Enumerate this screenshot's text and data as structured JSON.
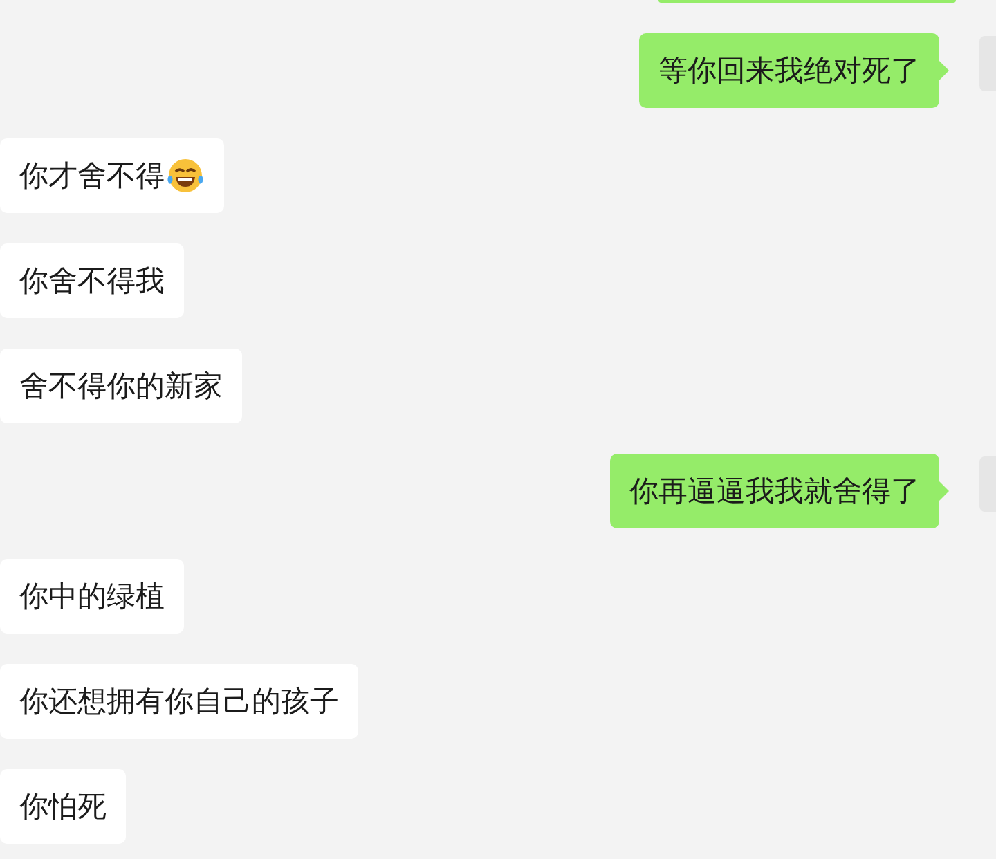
{
  "messages": [
    {
      "kind": "sent",
      "text": "等你回来我绝对死了",
      "emoji": false
    },
    {
      "kind": "received",
      "text": "你才舍不得",
      "emoji": true
    },
    {
      "kind": "received",
      "text": "你舍不得我",
      "emoji": false
    },
    {
      "kind": "received",
      "text": "舍不得你的新家",
      "emoji": false
    },
    {
      "kind": "sent",
      "text": "你再逼逼我我就舍得了",
      "emoji": false
    },
    {
      "kind": "received",
      "text": "你中的绿植",
      "emoji": false
    },
    {
      "kind": "received",
      "text": "你还想拥有你自己的孩子",
      "emoji": false
    },
    {
      "kind": "received",
      "text": "你怕死",
      "emoji": false
    }
  ]
}
